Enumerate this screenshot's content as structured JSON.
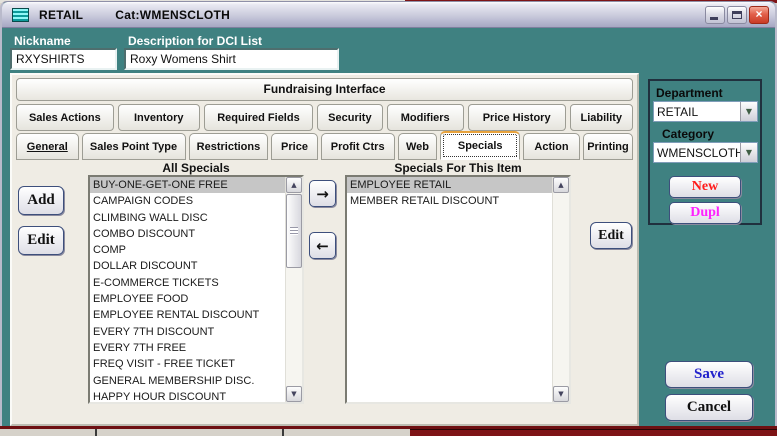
{
  "window": {
    "title": "RETAIL",
    "title_category": "Cat:WMENSCLOTH"
  },
  "fields": {
    "nickname_label": "Nickname",
    "nickname_value": "RXYSHIRTS",
    "description_label": "Description for DCI List",
    "description_value": "Roxy Womens Shirt"
  },
  "panel": {
    "header": "Fundraising Interface",
    "tabs_row1": [
      "Sales Actions",
      "Inventory",
      "Required Fields",
      "Security",
      "Modifiers",
      "Price History",
      "Liability"
    ],
    "tabs_row2": [
      "General",
      "Sales Point Type",
      "Restrictions",
      "Price",
      "Profit Ctrs",
      "Web",
      "Specials",
      "Action",
      "Printing"
    ],
    "active_tab": "Specials"
  },
  "all_specials": {
    "title": "All Specials",
    "selected": "BUY-ONE-GET-ONE FREE",
    "items": [
      "BUY-ONE-GET-ONE FREE",
      "CAMPAIGN CODES",
      "CLIMBING WALL DISC",
      "COMBO DISCOUNT",
      "COMP",
      "DOLLAR DISCOUNT",
      "E-COMMERCE TICKETS",
      "EMPLOYEE FOOD",
      "EMPLOYEE RENTAL DISCOUNT",
      "EVERY 7TH DISCOUNT",
      "EVERY 7TH FREE",
      "FREQ VISIT - FREE TICKET",
      "GENERAL MEMBERSHIP DISC.",
      "HAPPY HOUR DISCOUNT"
    ],
    "add_label": "Add",
    "edit_label": "Edit"
  },
  "item_specials": {
    "title": "Specials For This Item",
    "selected": "EMPLOYEE RETAIL",
    "items": [
      "EMPLOYEE RETAIL",
      "MEMBER RETAIL DISCOUNT"
    ],
    "edit_label": "Edit"
  },
  "side": {
    "department_label": "Department",
    "department_value": "RETAIL",
    "category_label": "Category",
    "category_value": "WMENSCLOTH",
    "new_label": "New",
    "dupl_label": "Dupl"
  },
  "footer": {
    "save_label": "Save",
    "cancel_label": "Cancel"
  },
  "icons": {
    "close": "×",
    "move_right": "→",
    "move_left": "←",
    "scroll_up": "▲",
    "scroll_down": "▼",
    "combo_arrow": "▼"
  },
  "colors": {
    "teal_background": "#3F8181",
    "active_tab_accent": "#E8A33D",
    "save_text": "#2222CC",
    "new_text": "#FF1A1A",
    "dupl_text": "#FF22FF",
    "selection_gray": "#C6C6C6",
    "close_button_red": "#C93B26"
  }
}
